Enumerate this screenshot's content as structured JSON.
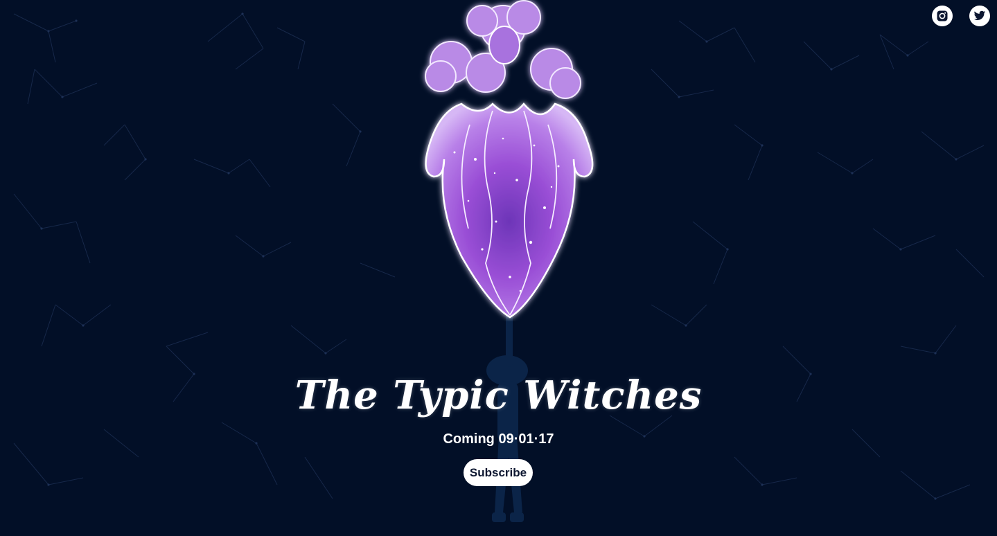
{
  "header": {
    "social": [
      {
        "name": "instagram-icon"
      },
      {
        "name": "twitter-icon"
      }
    ]
  },
  "hero": {
    "title": "The Typic Witches",
    "coming": "Coming 09·01·17",
    "subscribe_label": "Subscribe"
  },
  "colors": {
    "background": "#020f27",
    "illustration_purple": "#8a3fc8",
    "text": "#ffffff"
  }
}
